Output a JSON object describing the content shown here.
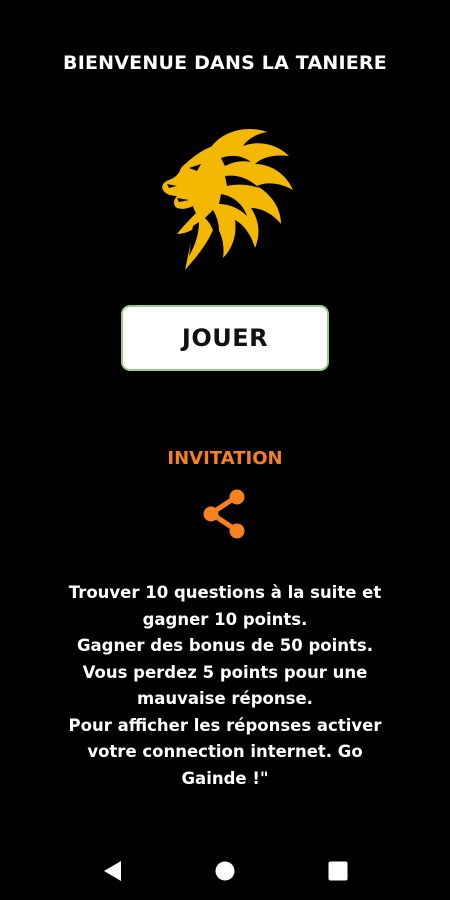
{
  "header": {
    "title": "BIENVENUE DANS LA TANIERE"
  },
  "main": {
    "logo_icon": "lion-head-icon",
    "play_button_label": "JOUER",
    "invitation_label": "INVITATION",
    "share_icon": "share-icon",
    "rules_lines": [
      "Trouver 10 questions à la suite  et",
      "gagner 10 points.",
      "Gagner des bonus de 50 points.          ",
      "Vous perdez 5 points pour une",
      "mauvaise réponse.",
      "Pour afficher les réponses activer",
      "votre connection  internet.  Go",
      "Gainde !\""
    ]
  },
  "navbar": {
    "back_icon": "back-triangle-icon",
    "home_icon": "home-circle-icon",
    "recents_icon": "recents-square-icon"
  },
  "colors": {
    "background": "#000000",
    "accent_orange": "#f6821f",
    "lion_gold": "#f5b800",
    "button_border": "#9bc98f"
  }
}
